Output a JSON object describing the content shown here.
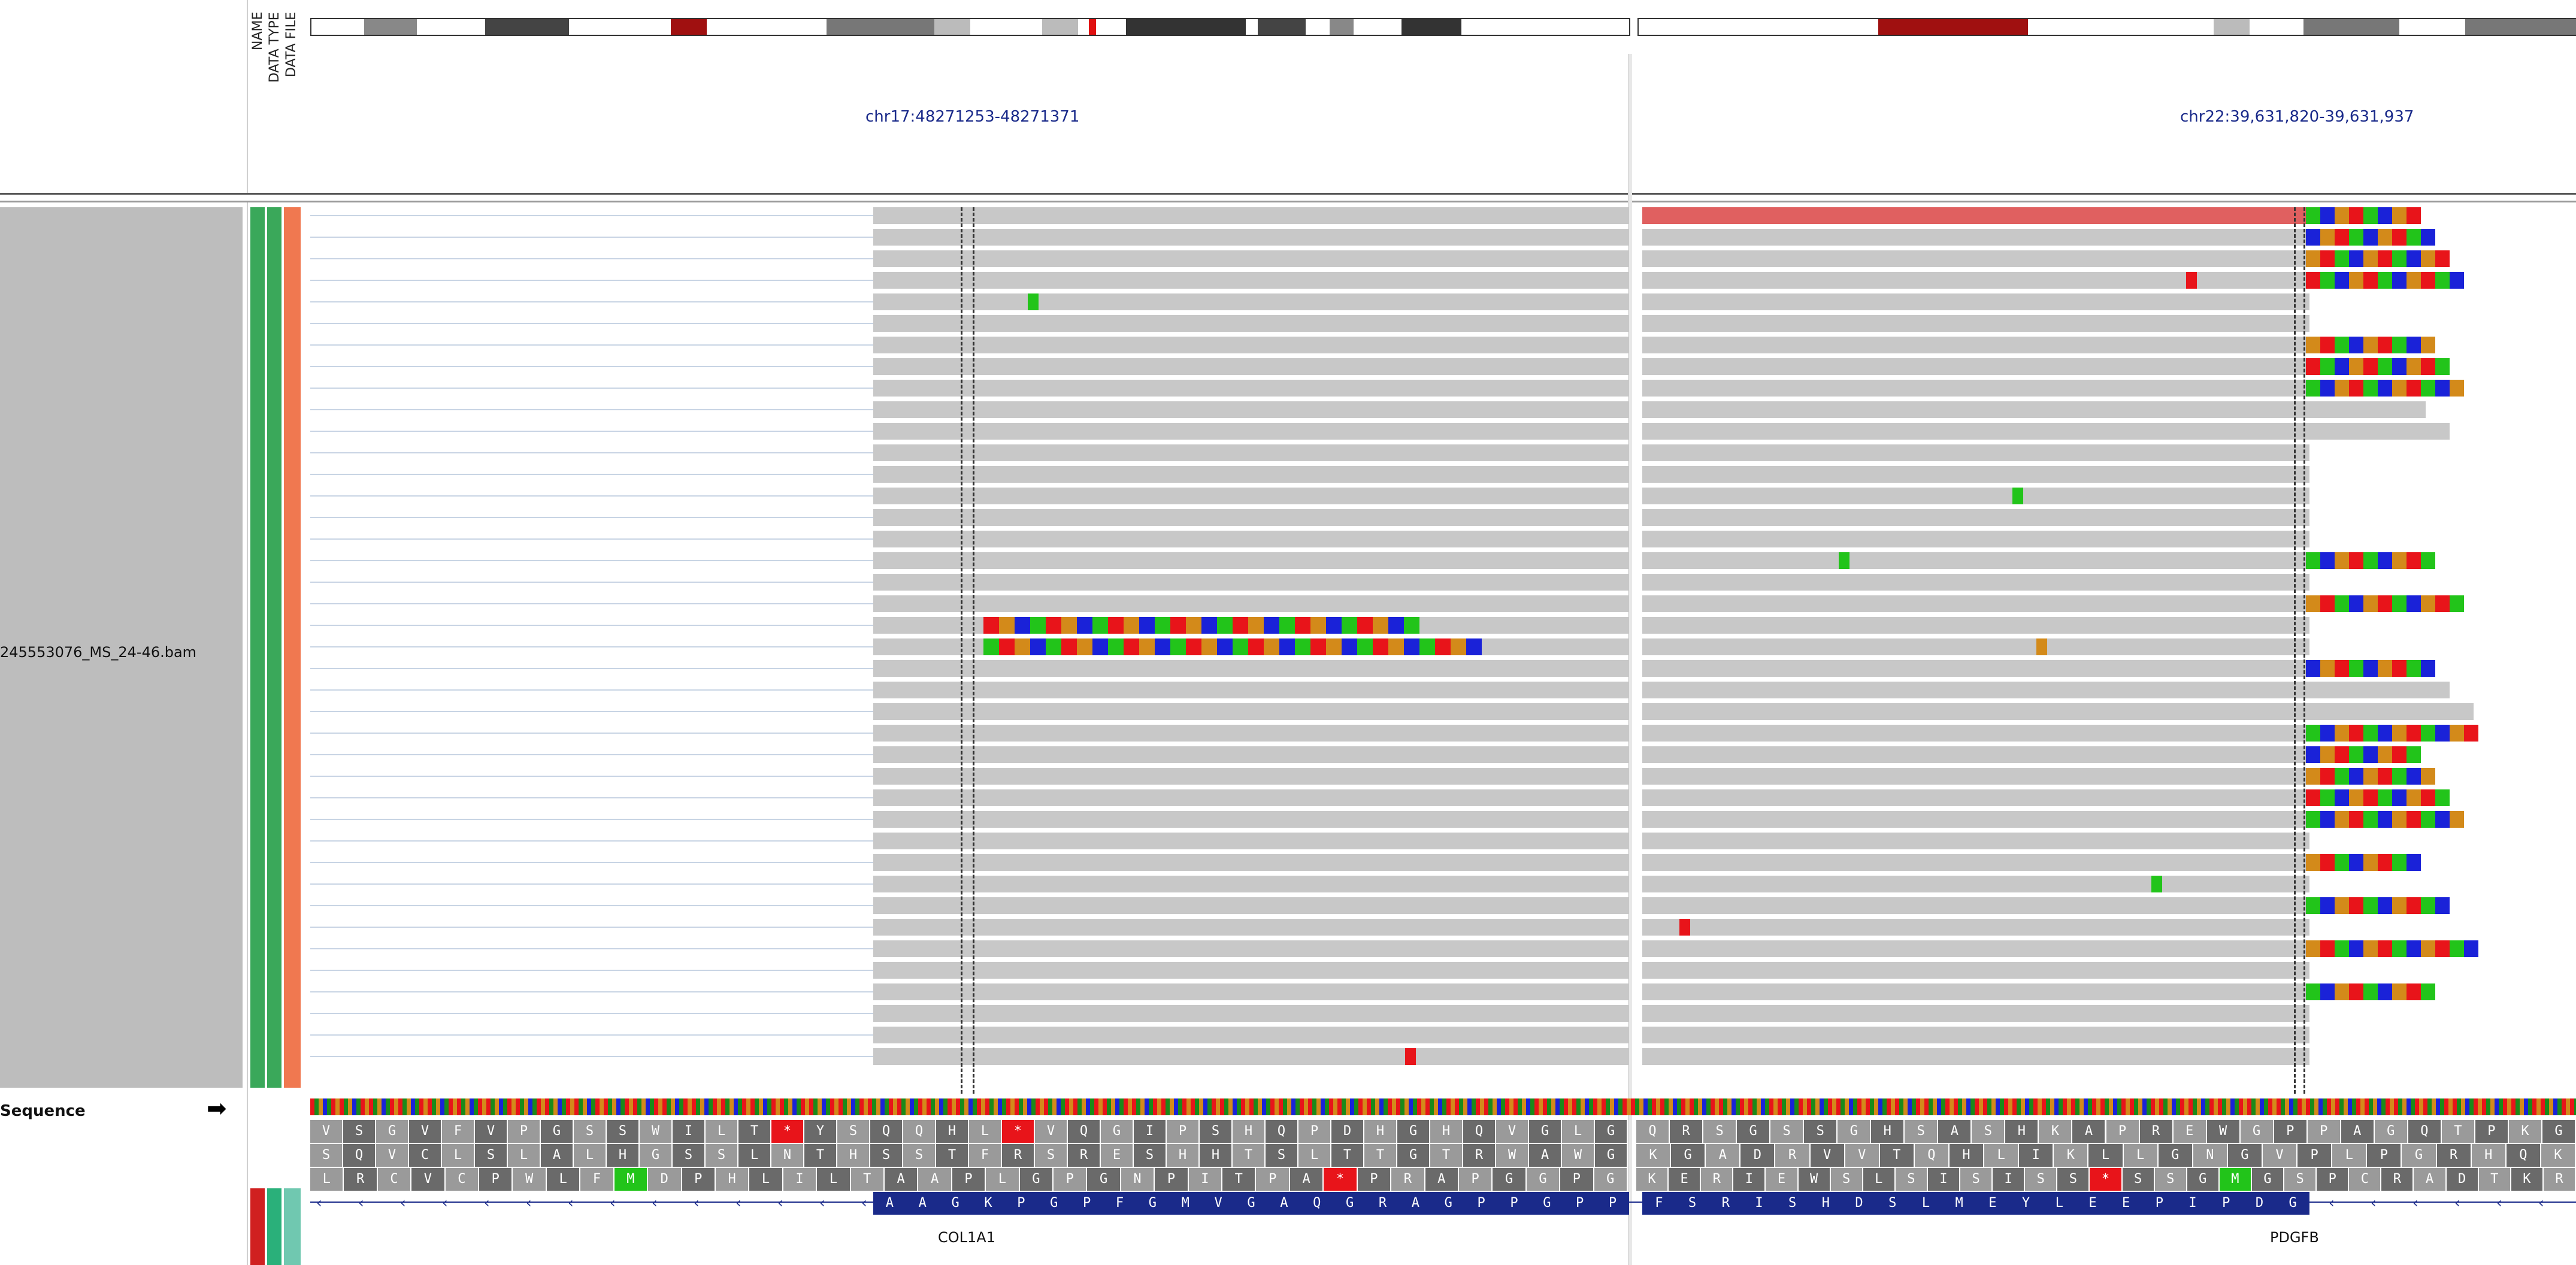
{
  "sample": {
    "bam_name": "245553076_MS_24-46.bam"
  },
  "attribute_headers": [
    "NAME",
    "DATA TYPE",
    "DATA FILE"
  ],
  "loci": [
    "chr17:48271253-48271371",
    "chr22:39,631,820-39,631,937"
  ],
  "sequence_track": {
    "label": "Sequence",
    "strand_arrow": "➡"
  },
  "genes": [
    {
      "name": "COL1A1",
      "exon_aa": [
        "A",
        "A",
        "G",
        "K",
        "P",
        "G",
        "P",
        "F",
        "G",
        "M",
        "V",
        "G",
        "A",
        "Q",
        "G",
        "R",
        "A",
        "G",
        "P",
        "P",
        "G",
        "P",
        "P"
      ]
    },
    {
      "name": "PDGFB",
      "exon_aa": [
        "F",
        "S",
        "R",
        "I",
        "S",
        "H",
        "D",
        "S",
        "L",
        "M",
        "E",
        "Y",
        "L",
        "E",
        "E",
        "P",
        "I",
        "P",
        "D",
        "G"
      ]
    }
  ],
  "translation_frames": {
    "left": [
      "VSGVFVPGSSWILT*YSQQHL*VQGIPSHQPDHGHQVGLG",
      "SQVCLSLALHGSSLNTHSSTFRSRESHHTSLTTGTRWAWG",
      "LRCVCPWLFMDPHLILTAAPLGPGNPITPA*PRAPGGPG"
    ],
    "right": [
      "QRSGSSGHSASHKAPREWGPPAGQTPKG",
      "KGADRVVTQHLIKLLGNGVPLPGRHQK",
      "KERIEWSLSISISS*SSGMGSPCRADTKR"
    ]
  },
  "colors": {
    "read": "#c8c8c8",
    "split_read": "#e06060",
    "mm_A": "#22c41a",
    "mm_C": "#1a22d8",
    "mm_G": "#d38a1a",
    "mm_T": "#e8141a",
    "locus_text": "#1a2a8a",
    "attr_green": "#3aa85a",
    "attr_orange": "#f07850"
  }
}
